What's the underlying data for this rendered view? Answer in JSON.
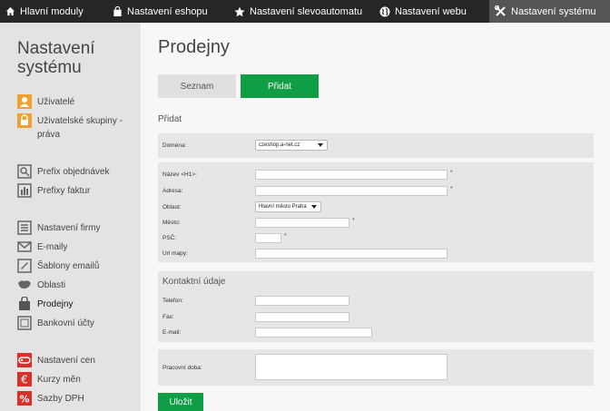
{
  "topbar": {
    "tabs": [
      {
        "label": "Hlavní moduly",
        "icon": "home-icon"
      },
      {
        "label": "Nastavení eshopu",
        "icon": "shopping-bag-icon"
      },
      {
        "label": "Nastavení slevoautomatu",
        "icon": "star-icon"
      },
      {
        "label": "Nastavení webu",
        "icon": "globe-icon"
      },
      {
        "label": "Nastavení systému",
        "icon": "tools-icon",
        "active": true
      }
    ]
  },
  "sidebar": {
    "title": "Nastavení systému",
    "items": [
      {
        "label": "Uživatelé",
        "icon": "user-icon"
      },
      {
        "label": "Uživatelské skupiny - práva",
        "icon": "lock-icon"
      },
      {
        "label": "Prefix objednávek",
        "icon": "settings-search-icon"
      },
      {
        "label": "Prefixy faktur",
        "icon": "bar-chart-icon"
      },
      {
        "label": "Nastavení firmy",
        "icon": "list-icon"
      },
      {
        "label": "E-maily",
        "icon": "envelope-icon"
      },
      {
        "label": "Šablony emailů",
        "icon": "template-icon"
      },
      {
        "label": "Oblasti",
        "icon": "map-icon"
      },
      {
        "label": "Prodejny",
        "icon": "store-icon",
        "active": true
      },
      {
        "label": "Bankovní účty",
        "icon": "bank-icon"
      },
      {
        "label": "Nastavení cen",
        "icon": "price-tag-icon"
      },
      {
        "label": "Kurzy měn",
        "icon": "euro-icon"
      },
      {
        "label": "Sazby DPH",
        "icon": "percent-icon"
      }
    ]
  },
  "main": {
    "title": "Prodejny",
    "tab_list": "Seznam",
    "tab_add": "Přidat",
    "section_heading": "Přidat",
    "domain": {
      "label": "Doména:",
      "value": "czeshop.a-net.cz"
    },
    "address": {
      "name_label": "Název <H1>:",
      "address_label": "Adresa:",
      "region_label": "Oblast:",
      "region_value": "Hlavní město Praha",
      "city_label": "Město:",
      "zip_label": "PSČ:",
      "map_label": "Url mapy:",
      "required_mark": "*"
    },
    "contacts": {
      "heading": "Kontaktní údaje",
      "phone_label": "Telefon:",
      "fax_label": "Fax:",
      "email_label": "E-mail:"
    },
    "hours": {
      "label": "Pracovní doba:"
    },
    "save_label": "Uložit"
  },
  "colors": {
    "accent": "#0f9d46",
    "topbar": "#262626",
    "sidebar": "#e3e3e3",
    "icon_orange": "#f0a030",
    "icon_red": "#d9302c",
    "icon_gray": "#666666"
  }
}
